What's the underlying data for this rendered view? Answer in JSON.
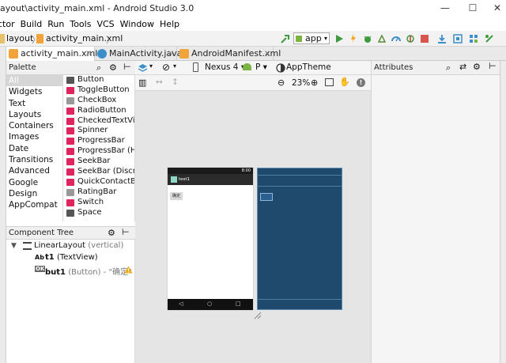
{
  "window": {
    "title": "ayout\\activity_main.xml - Android Studio 3.0",
    "minimize": "—",
    "maximize": "☐",
    "close": "✕"
  },
  "menu": [
    "ctor",
    "Build",
    "Run",
    "Tools",
    "VCS",
    "Window",
    "Help"
  ],
  "breadcrumb": {
    "folder": "layout",
    "file": "activity_main.xml"
  },
  "toolbar": {
    "run_config": "app"
  },
  "tabs": [
    {
      "label": "activity_main.xml",
      "active": true,
      "icon_color": "#f2a33a"
    },
    {
      "label": "MainActivity.java",
      "active": false,
      "icon_color": "#3d8fc9"
    },
    {
      "label": "AndroidManifest.xml",
      "active": false,
      "icon_color": "#f2a33a"
    }
  ],
  "palette": {
    "title": "Palette",
    "categories": [
      "All",
      "Widgets",
      "Text",
      "Layouts",
      "Containers",
      "Images",
      "Date",
      "Transitions",
      "Advanced",
      "Google",
      "Design",
      "AppCompat"
    ],
    "items": [
      {
        "label": "Button",
        "icon": "ok-button-icon",
        "color": "#555555"
      },
      {
        "label": "ToggleButton",
        "icon": "toggle-icon",
        "color": "#e0245e"
      },
      {
        "label": "CheckBox",
        "icon": "checkbox-icon",
        "color": "#999999"
      },
      {
        "label": "RadioButton",
        "icon": "radio-icon",
        "color": "#e0245e"
      },
      {
        "label": "CheckedTextVi",
        "icon": "checked-text-icon",
        "color": "#e0245e"
      },
      {
        "label": "Spinner",
        "icon": "spinner-icon",
        "color": "#e0245e"
      },
      {
        "label": "ProgressBar",
        "icon": "progress-icon",
        "color": "#e0245e"
      },
      {
        "label": "ProgressBar (H",
        "icon": "progress-h-icon",
        "color": "#e0245e"
      },
      {
        "label": "SeekBar",
        "icon": "seekbar-icon",
        "color": "#e0245e"
      },
      {
        "label": "SeekBar (Discre",
        "icon": "seekbar-discrete-icon",
        "color": "#e0245e"
      },
      {
        "label": "QuickContactB",
        "icon": "quick-contact-icon",
        "color": "#e0245e"
      },
      {
        "label": "RatingBar",
        "icon": "star-icon",
        "color": "#999999"
      },
      {
        "label": "Switch",
        "icon": "switch-icon",
        "color": "#e0245e"
      },
      {
        "label": "Space",
        "icon": "space-icon",
        "color": "#555555"
      }
    ]
  },
  "design": {
    "device": "Nexus 4",
    "api": "P",
    "theme": "AppTheme",
    "zoom": "23%"
  },
  "preview": {
    "app_title": "test1",
    "button_label": "确定",
    "clock": "8:00"
  },
  "component_tree": {
    "title": "Component Tree",
    "root": {
      "name": "LinearLayout",
      "detail": "(vertical)"
    },
    "children": [
      {
        "icon_text": "Ab",
        "name": "t1",
        "detail": "(TextView)",
        "warning": false
      },
      {
        "icon_text": "OK",
        "name": "but1",
        "detail": "(Button) - \"确定\"",
        "warning": true
      }
    ]
  },
  "attributes": {
    "title": "Attributes"
  }
}
